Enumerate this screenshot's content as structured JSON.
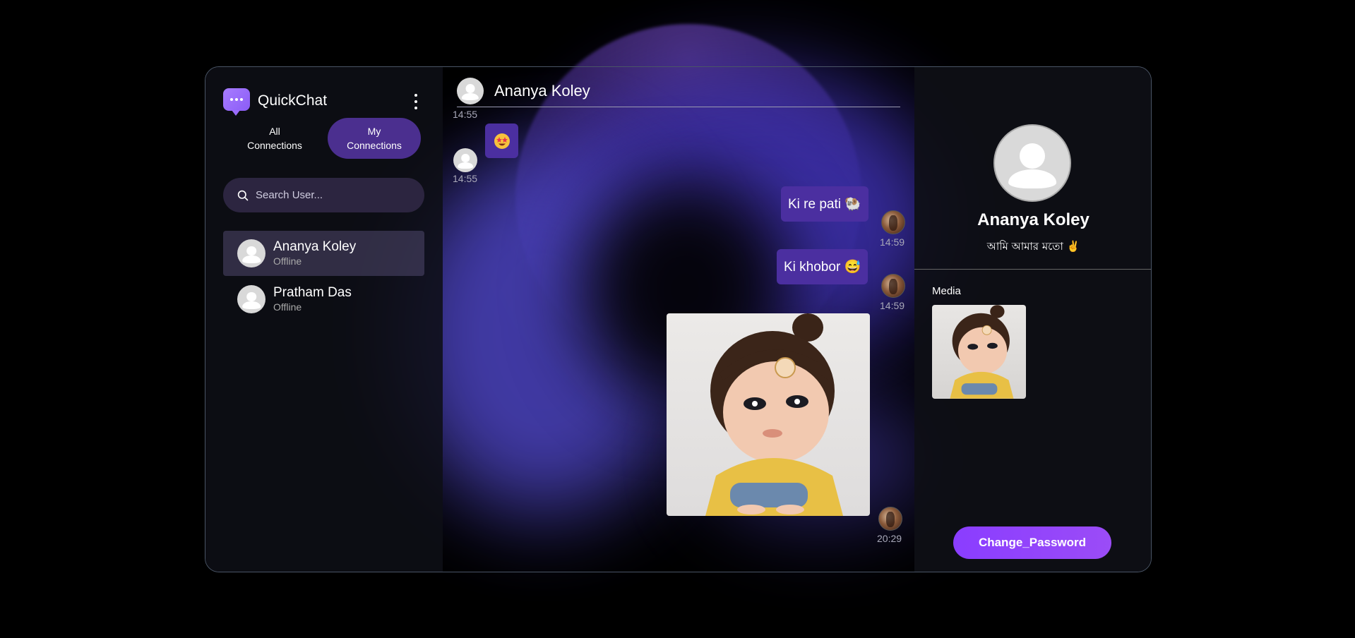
{
  "app": {
    "title": "QuickChat"
  },
  "tabs": [
    {
      "label": "All Connections",
      "active": false
    },
    {
      "label": "My Connections",
      "active": true
    }
  ],
  "search": {
    "placeholder": "Search User..."
  },
  "contacts": [
    {
      "name": "Ananya Koley",
      "status": "Offline",
      "active": true
    },
    {
      "name": "Pratham Das",
      "status": "Offline",
      "active": false
    }
  ],
  "chat": {
    "header_name": "Ananya Koley",
    "messages": [
      {
        "time": "14:55"
      },
      {
        "text": "",
        "emoji": "star-struck-emoji",
        "time": "14:55",
        "from": "them"
      },
      {
        "text": "Ki re pati 🐏",
        "time": "14:59",
        "from": "me"
      },
      {
        "text": "Ki khobor 😅",
        "time": "14:59",
        "from": "me"
      },
      {
        "image": "cartoon-girl-photo",
        "time": "20:29",
        "from": "me"
      }
    ]
  },
  "profile": {
    "name": "Ananya Koley",
    "bio": "আমি আমার মতো ✌️",
    "media_label": "Media",
    "change_password_label": "Change_Password"
  },
  "colors": {
    "accent": "#8b5cf6",
    "bubble": "#4b2fa0",
    "tab_active": "#4b2f8f",
    "panel": "#0e0f16"
  }
}
